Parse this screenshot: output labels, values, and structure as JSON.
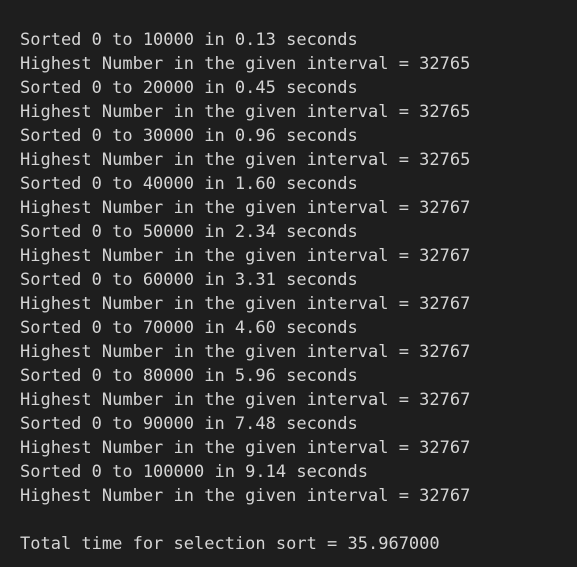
{
  "terminal": {
    "lines": [
      "Sorted 0 to 10000 in 0.13 seconds",
      "Highest Number in the given interval = 32765",
      "Sorted 0 to 20000 in 0.45 seconds",
      "Highest Number in the given interval = 32765",
      "Sorted 0 to 30000 in 0.96 seconds",
      "Highest Number in the given interval = 32765",
      "Sorted 0 to 40000 in 1.60 seconds",
      "Highest Number in the given interval = 32767",
      "Sorted 0 to 50000 in 2.34 seconds",
      "Highest Number in the given interval = 32767",
      "Sorted 0 to 60000 in 3.31 seconds",
      "Highest Number in the given interval = 32767",
      "Sorted 0 to 70000 in 4.60 seconds",
      "Highest Number in the given interval = 32767",
      "Sorted 0 to 80000 in 5.96 seconds",
      "Highest Number in the given interval = 32767",
      "Sorted 0 to 90000 in 7.48 seconds",
      "Highest Number in the given interval = 32767",
      "Sorted 0 to 100000 in 9.14 seconds",
      "Highest Number in the given interval = 32767"
    ],
    "total_line": "Total time for selection sort = 35.967000",
    "colors": {
      "background": "#1e1e1e",
      "text": "#d4d4d4"
    }
  }
}
